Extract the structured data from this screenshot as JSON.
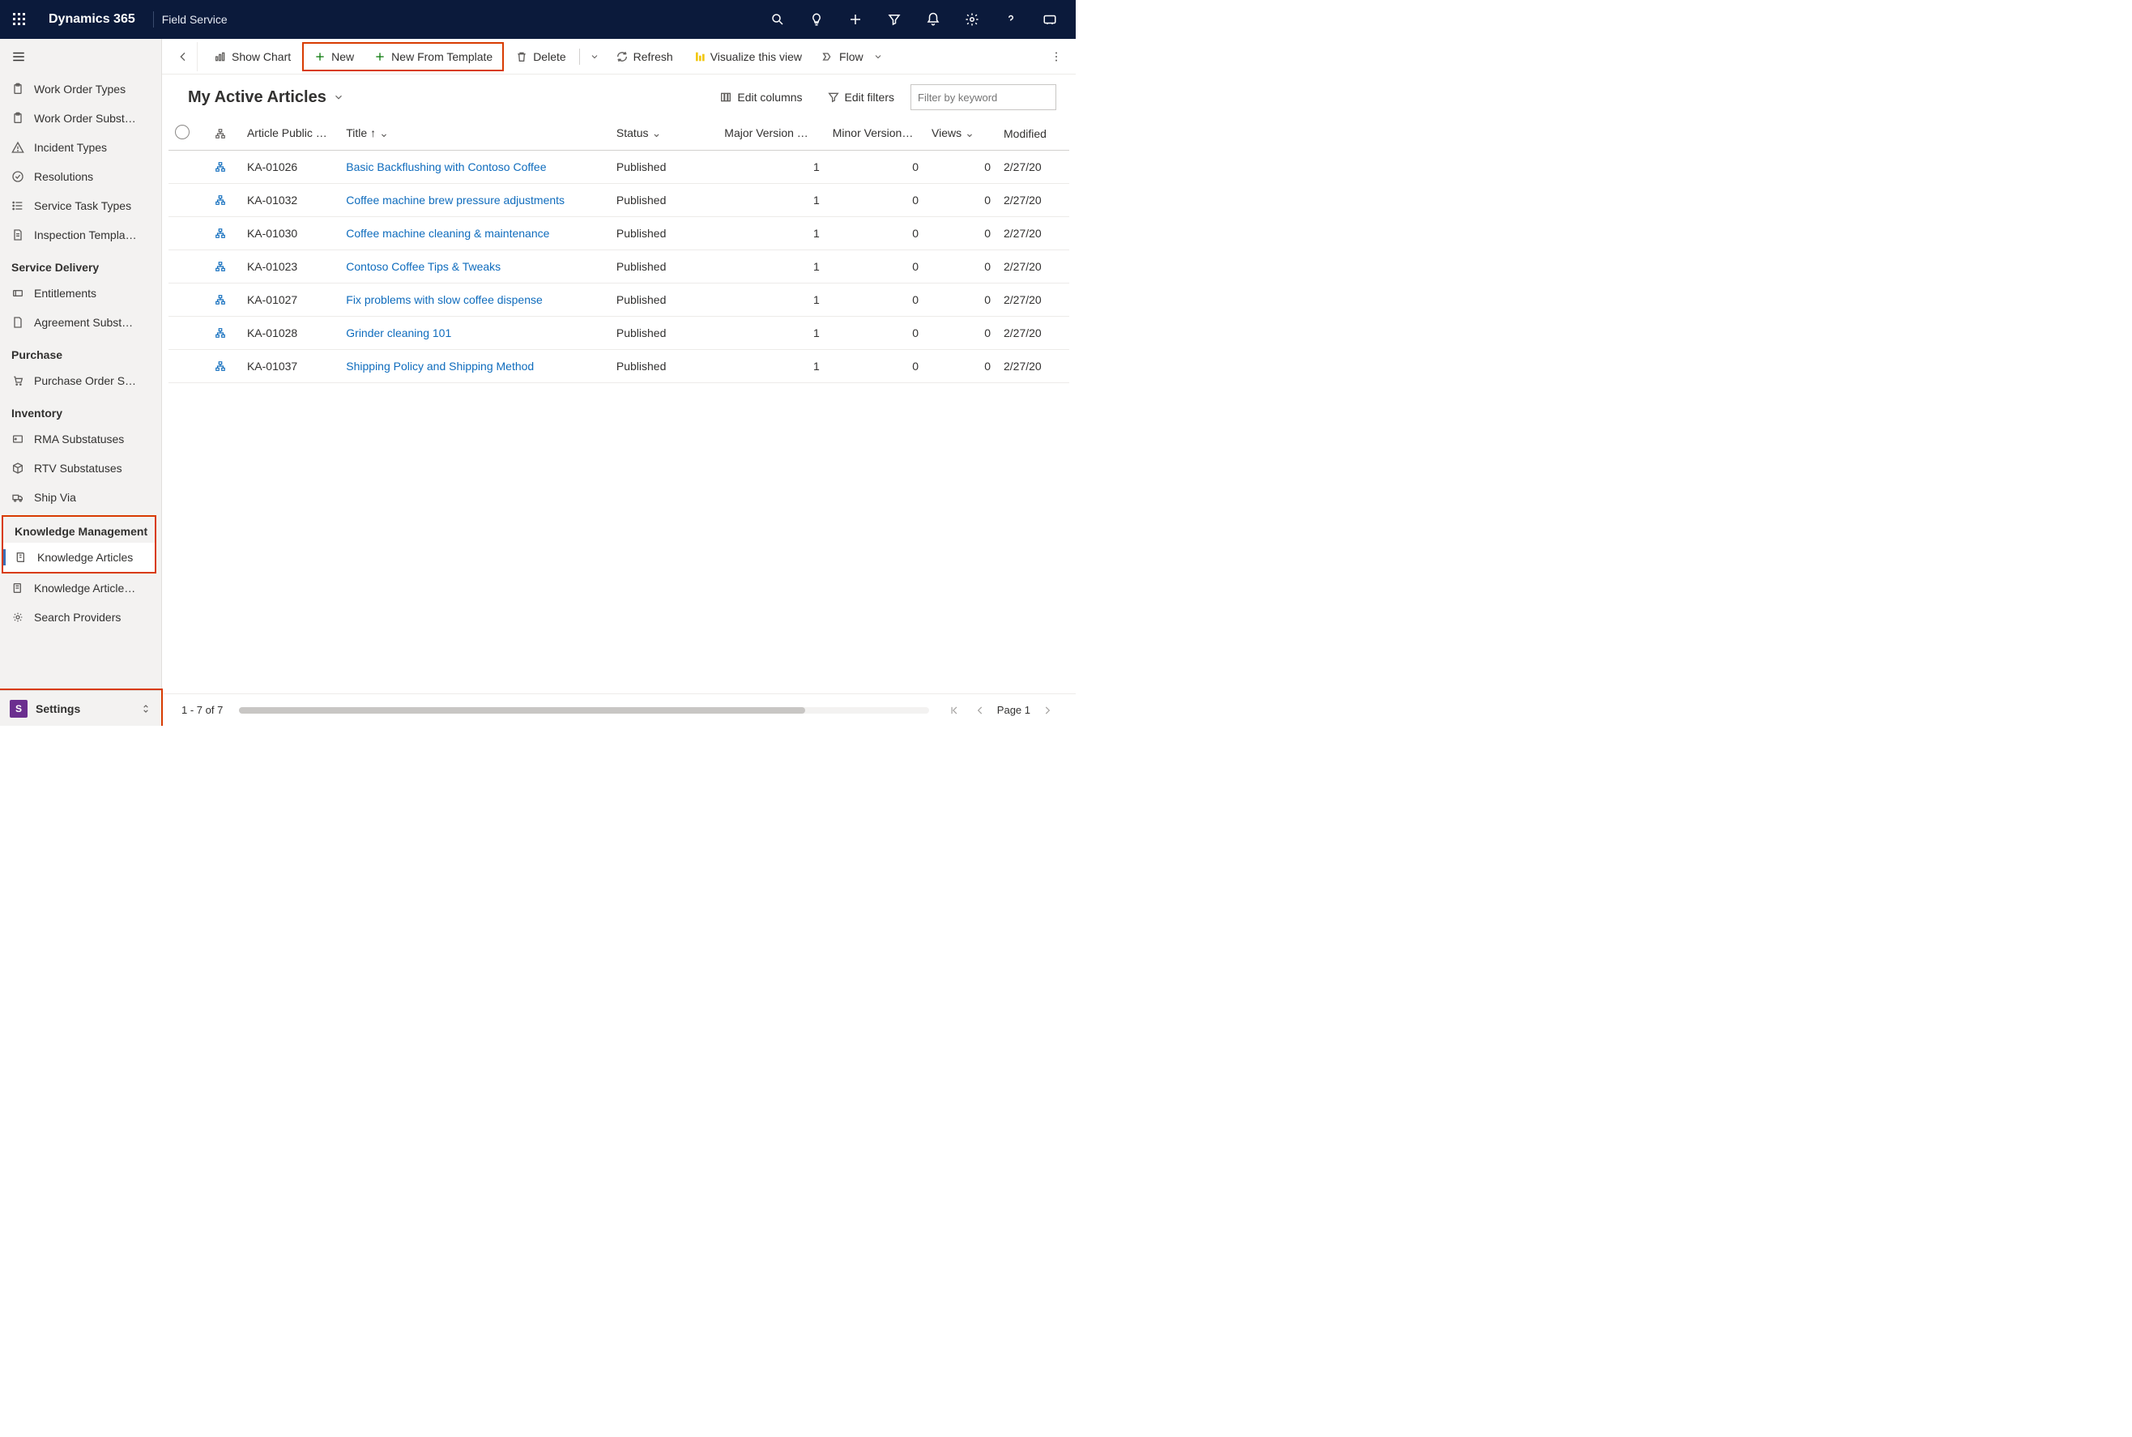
{
  "topbar": {
    "brand": "Dynamics 365",
    "app": "Field Service"
  },
  "sidebar": {
    "items_top": [
      {
        "label": "Work Order Types"
      },
      {
        "label": "Work Order Subst…"
      },
      {
        "label": "Incident Types"
      },
      {
        "label": "Resolutions"
      },
      {
        "label": "Service Task Types"
      },
      {
        "label": "Inspection Templa…"
      }
    ],
    "group_service": "Service Delivery",
    "items_service": [
      {
        "label": "Entitlements"
      },
      {
        "label": "Agreement Subst…"
      }
    ],
    "group_purchase": "Purchase",
    "items_purchase": [
      {
        "label": "Purchase Order S…"
      }
    ],
    "group_inventory": "Inventory",
    "items_inventory": [
      {
        "label": "RMA Substatuses"
      },
      {
        "label": "RTV Substatuses"
      },
      {
        "label": "Ship Via"
      }
    ],
    "group_km": "Knowledge Management",
    "items_km": [
      {
        "label": "Knowledge Articles"
      },
      {
        "label": "Knowledge Article…"
      },
      {
        "label": "Search Providers"
      }
    ],
    "footer": {
      "tile": "S",
      "label": "Settings"
    }
  },
  "cmdbar": {
    "show_chart": "Show Chart",
    "new_": "New",
    "new_template": "New From Template",
    "delete_": "Delete",
    "refresh": "Refresh",
    "visualize": "Visualize this view",
    "flow": "Flow"
  },
  "view": {
    "title": "My Active Articles",
    "edit_cols": "Edit columns",
    "edit_filters": "Edit filters",
    "filter_placeholder": "Filter by keyword"
  },
  "columns": {
    "num": "Article Public …",
    "title": "Title",
    "status": "Status",
    "major": "Major Version …",
    "minor": "Minor Version…",
    "views": "Views",
    "modified": "Modified"
  },
  "rows": [
    {
      "num": "KA-01026",
      "title": "Basic Backflushing with Contoso Coffee",
      "status": "Published",
      "maj": "1",
      "min": "0",
      "views": "0",
      "mod": "2/27/20"
    },
    {
      "num": "KA-01032",
      "title": "Coffee machine brew pressure adjustments",
      "status": "Published",
      "maj": "1",
      "min": "0",
      "views": "0",
      "mod": "2/27/20"
    },
    {
      "num": "KA-01030",
      "title": "Coffee machine cleaning & maintenance",
      "status": "Published",
      "maj": "1",
      "min": "0",
      "views": "0",
      "mod": "2/27/20"
    },
    {
      "num": "KA-01023",
      "title": "Contoso Coffee Tips & Tweaks",
      "status": "Published",
      "maj": "1",
      "min": "0",
      "views": "0",
      "mod": "2/27/20"
    },
    {
      "num": "KA-01027",
      "title": "Fix problems with slow coffee dispense",
      "status": "Published",
      "maj": "1",
      "min": "0",
      "views": "0",
      "mod": "2/27/20"
    },
    {
      "num": "KA-01028",
      "title": "Grinder cleaning 101",
      "status": "Published",
      "maj": "1",
      "min": "0",
      "views": "0",
      "mod": "2/27/20"
    },
    {
      "num": "KA-01037",
      "title": "Shipping Policy and Shipping Method",
      "status": "Published",
      "maj": "1",
      "min": "0",
      "views": "0",
      "mod": "2/27/20"
    }
  ],
  "footer": {
    "range": "1 - 7 of 7",
    "page": "Page 1"
  }
}
